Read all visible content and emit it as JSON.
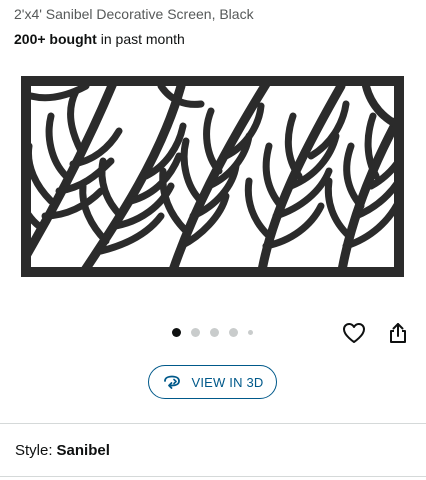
{
  "product": {
    "title": "2'x4' Sanibel Decorative Screen, Black",
    "bought_count": "200+ bought",
    "bought_suffix": " in past month"
  },
  "carousel": {
    "total_dots": 5,
    "active_index": 0
  },
  "actions": {
    "view_3d_label": "VIEW IN 3D"
  },
  "style": {
    "label": "Style:",
    "value": "Sanibel"
  },
  "colors": {
    "link": "#00598a",
    "panel": "#2b2b2b"
  },
  "icons": [
    "heart-icon",
    "share-icon",
    "rotate-3d-icon"
  ]
}
